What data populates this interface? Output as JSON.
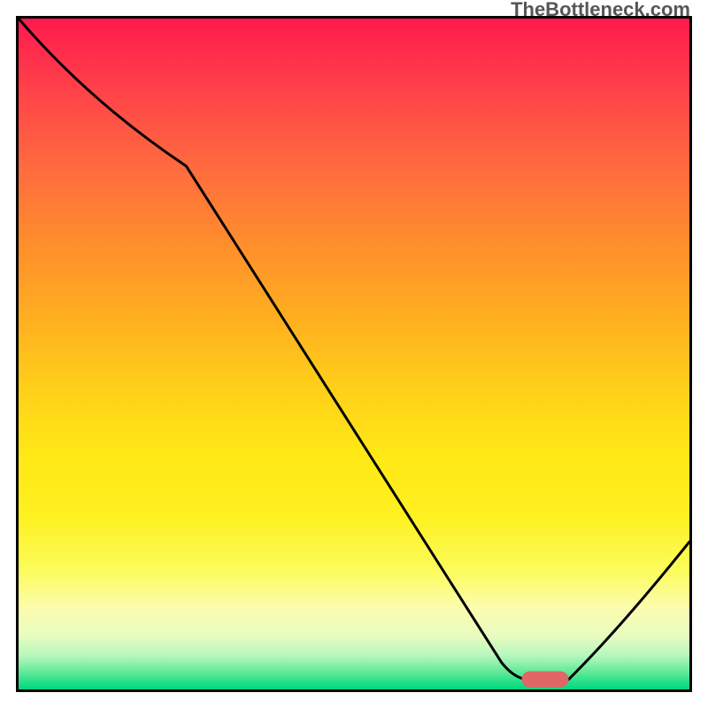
{
  "watermark": "TheBottleneck.com",
  "chart_data": {
    "type": "line",
    "title": "",
    "xlabel": "",
    "ylabel": "",
    "xlim": [
      0,
      100
    ],
    "ylim": [
      0,
      100
    ],
    "grid": false,
    "series": [
      {
        "name": "curve",
        "color": "#000000",
        "points": [
          {
            "x": 0,
            "y": 100
          },
          {
            "x": 25,
            "y": 78
          },
          {
            "x": 72,
            "y": 4
          },
          {
            "x": 76,
            "y": 1.5
          },
          {
            "x": 82,
            "y": 1.5
          },
          {
            "x": 100,
            "y": 22
          }
        ]
      }
    ],
    "markers": [
      {
        "name": "highlight-pill",
        "shape": "rounded-rect",
        "x_center": 78.5,
        "y_center": 1.5,
        "width": 7,
        "height": 2.4,
        "fill": "#e06666"
      }
    ],
    "background_gradient": {
      "direction": "vertical",
      "stops": [
        {
          "pos": 0.0,
          "color": "#ff1a4d"
        },
        {
          "pos": 0.33,
          "color": "#ff8c2d"
        },
        {
          "pos": 0.65,
          "color": "#ffe815"
        },
        {
          "pos": 0.88,
          "color": "#fcfcb0"
        },
        {
          "pos": 1.0,
          "color": "#00d684"
        }
      ]
    }
  }
}
